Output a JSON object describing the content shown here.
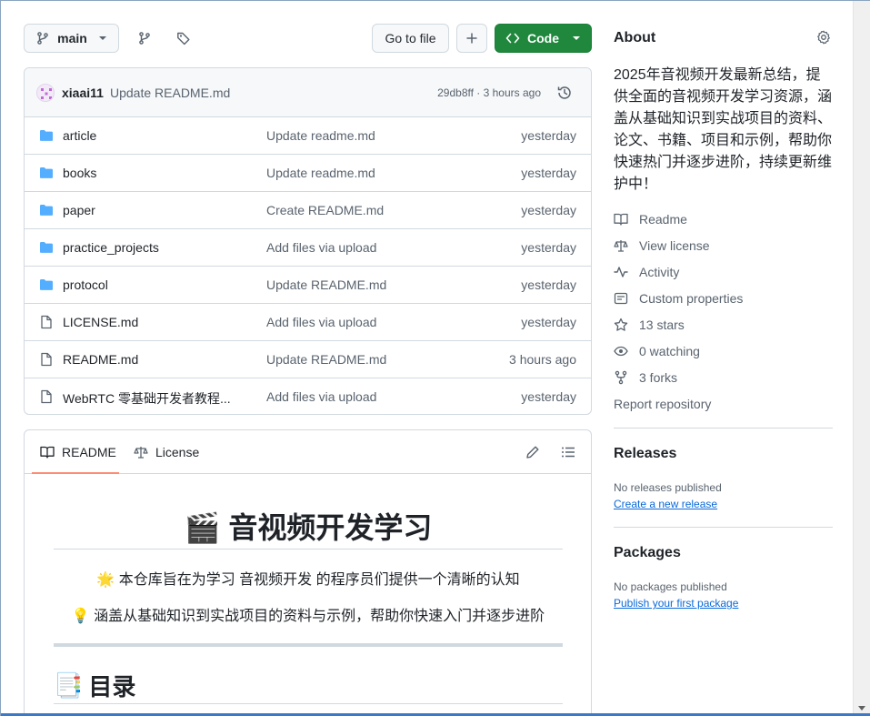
{
  "toolbar": {
    "branch_label": "main",
    "go_to_file_label": "Go to file",
    "code_label": "Code"
  },
  "commit": {
    "author": "xiaai11",
    "message": "Update README.md",
    "meta": "29db8ff · 3 hours ago"
  },
  "files": [
    {
      "name": "article",
      "message": "Update readme.md",
      "date": "yesterday",
      "type": "folder"
    },
    {
      "name": "books",
      "message": "Update readme.md",
      "date": "yesterday",
      "type": "folder"
    },
    {
      "name": "paper",
      "message": "Create README.md",
      "date": "yesterday",
      "type": "folder"
    },
    {
      "name": "practice_projects",
      "message": "Add files via upload",
      "date": "yesterday",
      "type": "folder"
    },
    {
      "name": "protocol",
      "message": "Update README.md",
      "date": "yesterday",
      "type": "folder"
    },
    {
      "name": "LICENSE.md",
      "message": "Add files via upload",
      "date": "yesterday",
      "type": "file"
    },
    {
      "name": "README.md",
      "message": "Update README.md",
      "date": "3 hours ago",
      "type": "file"
    },
    {
      "name": "WebRTC 零基础开发者教程...",
      "message": "Add files via upload",
      "date": "yesterday",
      "type": "file"
    }
  ],
  "readme": {
    "tab_readme": "README",
    "tab_license": "License",
    "title_emoji": "🎬",
    "title": "音视频开发学习",
    "line1_emoji": "🌟",
    "line1": "本仓库旨在为学习 音视频开发 的程序员们提供一个清晰的认知",
    "line2_emoji": "💡",
    "line2": "涵盖从基础知识到实战项目的资料与示例，帮助你快速入门并逐步进阶",
    "h2_emoji": "📑",
    "h2": "目录"
  },
  "about": {
    "title": "About",
    "description": "2025年音视频开发最新总结，提供全面的音视频开发学习资源，涵盖从基础知识到实战项目的资料、论文、书籍、项目和示例，帮助你快速热门并逐步进阶，持续更新维护中！",
    "readme": "Readme",
    "license": "View license",
    "activity": "Activity",
    "custom_properties": "Custom properties",
    "stars": "13 stars",
    "watching": "0 watching",
    "forks": "3 forks",
    "report": "Report repository"
  },
  "releases": {
    "title": "Releases",
    "empty": "No releases published",
    "link": "Create a new release"
  },
  "packages": {
    "title": "Packages",
    "empty": "No packages published",
    "link": "Publish your first package"
  },
  "colors": {
    "code_button": "#1f883d",
    "folder_icon": "#54aeff",
    "link": "#0969da",
    "tab_underline": "#fd8c73"
  }
}
